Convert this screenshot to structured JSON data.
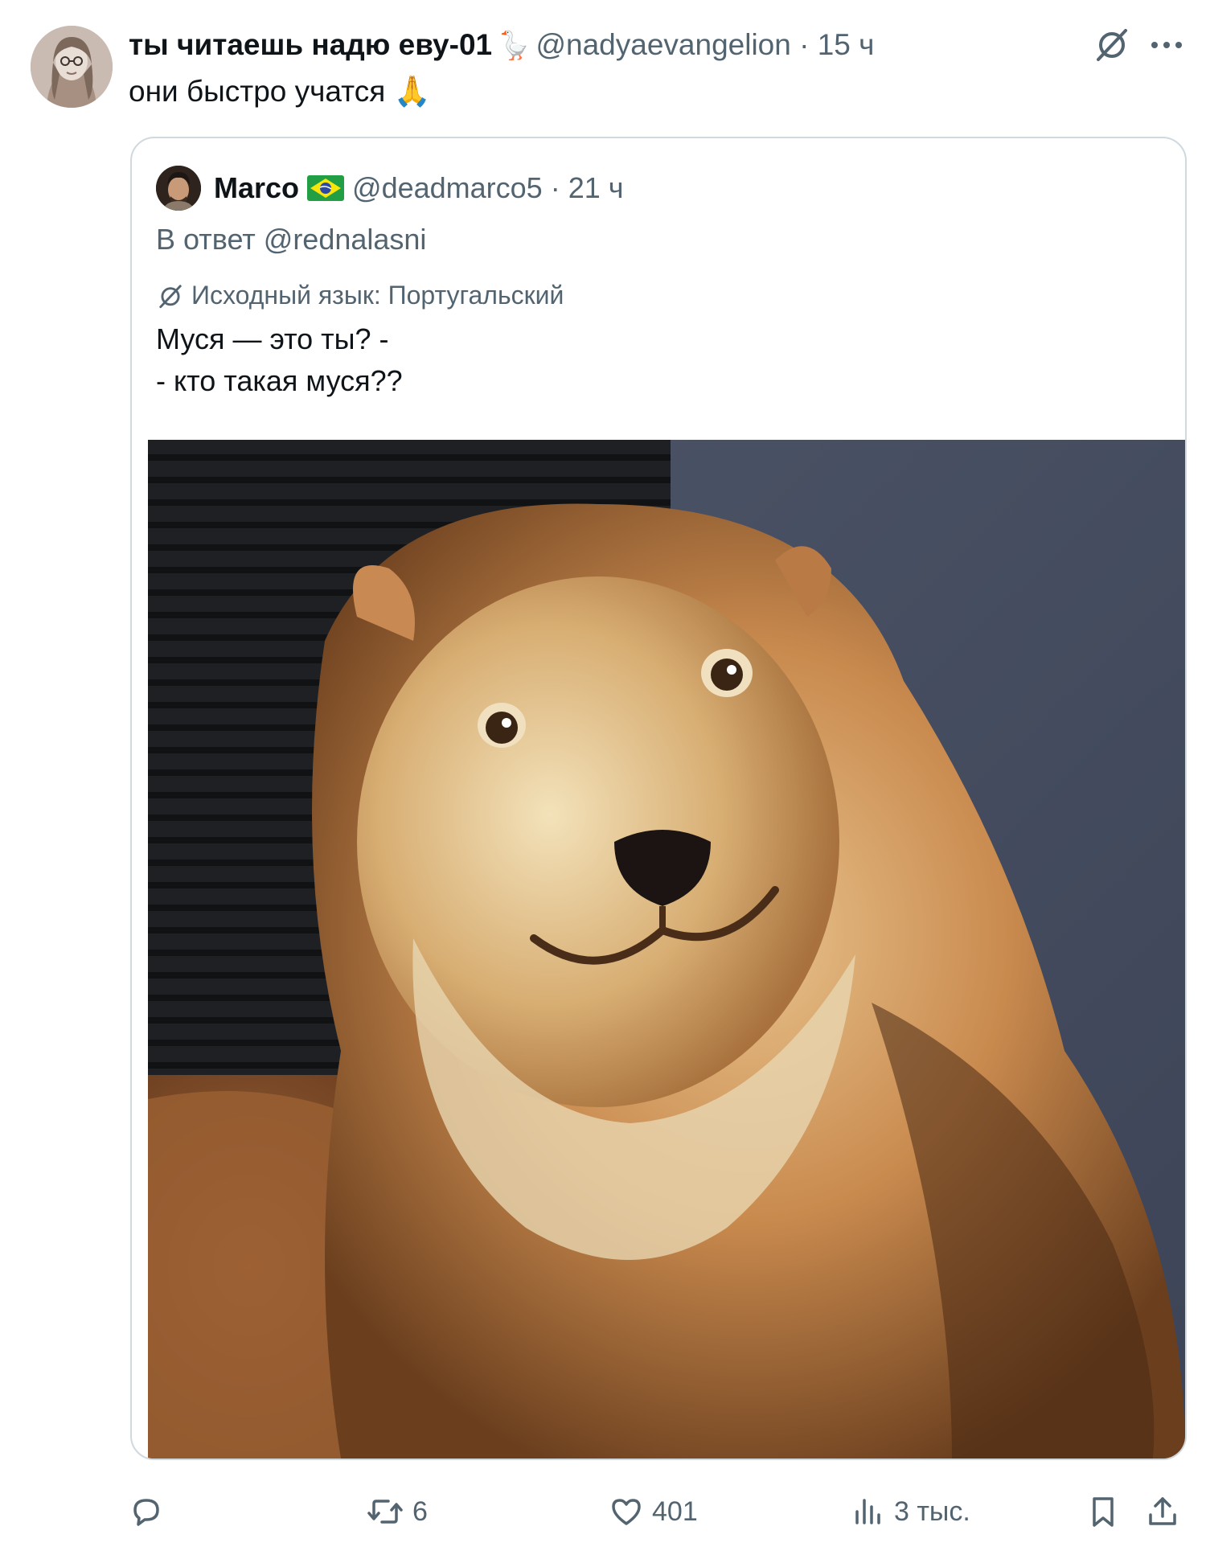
{
  "tweet": {
    "display_name": "ты читаешь надю еву-01",
    "name_emoji": "🪿",
    "handle": "@nadyaevangelion",
    "separator": " · ",
    "time": "15 ч",
    "text": "они быстро учатся",
    "text_emoji": "🙏"
  },
  "quote": {
    "display_name": "Marco",
    "handle": "@deadmarco5",
    "separator": " · ",
    "time": "21 ч",
    "reply_to": "В ответ @rednalasni",
    "source_language": "Исходный язык: Португальский",
    "text_lines": [
      "Муся — это ты? -",
      "- кто такая муся??"
    ]
  },
  "actions": {
    "reply_count": "",
    "retweet_count": "6",
    "like_count": "401",
    "views_count": "3 тыс."
  },
  "colors": {
    "text_primary": "#0f1419",
    "text_secondary": "#536471",
    "border": "#cfd9de"
  },
  "icons": [
    "grok-icon",
    "more-icon",
    "translate-icon",
    "reply-icon",
    "retweet-icon",
    "like-icon",
    "views-icon",
    "bookmark-icon",
    "share-icon"
  ]
}
